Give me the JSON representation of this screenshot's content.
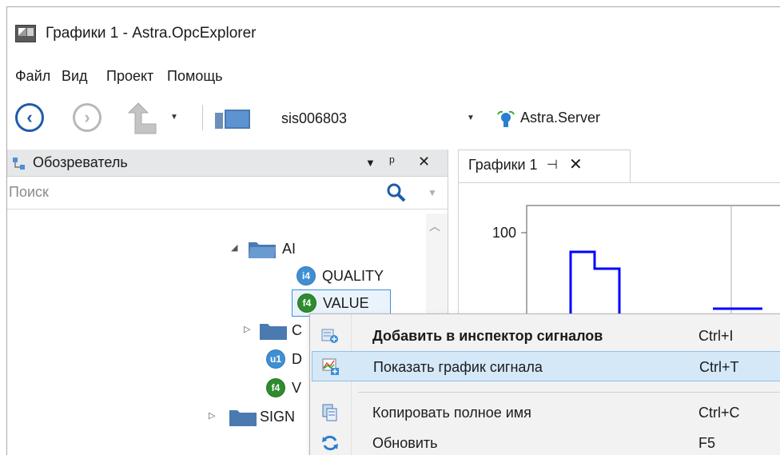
{
  "window": {
    "title": "Графики 1 - Astra.OpcExplorer"
  },
  "menu": {
    "items": [
      "Файл",
      "Вид",
      "Проект",
      "Помощь"
    ]
  },
  "toolbar": {
    "host": "sis006803",
    "server": "Astra.Server",
    "icons": [
      "back-icon",
      "forward-icon",
      "up-icon",
      "server-icon",
      "opc-server-icon"
    ]
  },
  "explorer": {
    "title": "Обозреватель",
    "pin_glyph": "ᵖ",
    "close_glyph": "✕",
    "search_placeholder": "Поиск",
    "tree": [
      {
        "label": "AI",
        "kind": "folder",
        "expander": "◢"
      },
      {
        "label": "QUALITY",
        "kind": "item",
        "badge": "i4"
      },
      {
        "label": "VALUE",
        "kind": "item",
        "badge": "f4"
      },
      {
        "label": "C",
        "kind": "folder",
        "expander": "▷"
      },
      {
        "label": "D",
        "kind": "item",
        "badge": "u1"
      },
      {
        "label": "V",
        "kind": "item",
        "badge": "f4"
      },
      {
        "label": "SIGN",
        "kind": "folder",
        "expander": "▷"
      }
    ]
  },
  "document": {
    "tab_label": "Графики 1",
    "tab_pin": "⊣⊢",
    "tab_close": "✕"
  },
  "chart_data": {
    "type": "line",
    "y_tick_labels": [
      "100"
    ],
    "series_color": "#0000ff"
  },
  "context_menu": {
    "items": [
      {
        "label": "Добавить в инспектор сигналов",
        "shortcut": "Ctrl+I",
        "icon": "add-to-inspector-icon",
        "bold": true
      },
      {
        "label": "Показать график сигнала",
        "shortcut": "Ctrl+T",
        "icon": "show-chart-icon",
        "highlighted": true
      },
      {
        "label": "Копировать полное имя",
        "shortcut": "Ctrl+C",
        "icon": "copy-icon"
      },
      {
        "label": "Обновить",
        "shortcut": "F5",
        "icon": "refresh-icon"
      }
    ]
  }
}
